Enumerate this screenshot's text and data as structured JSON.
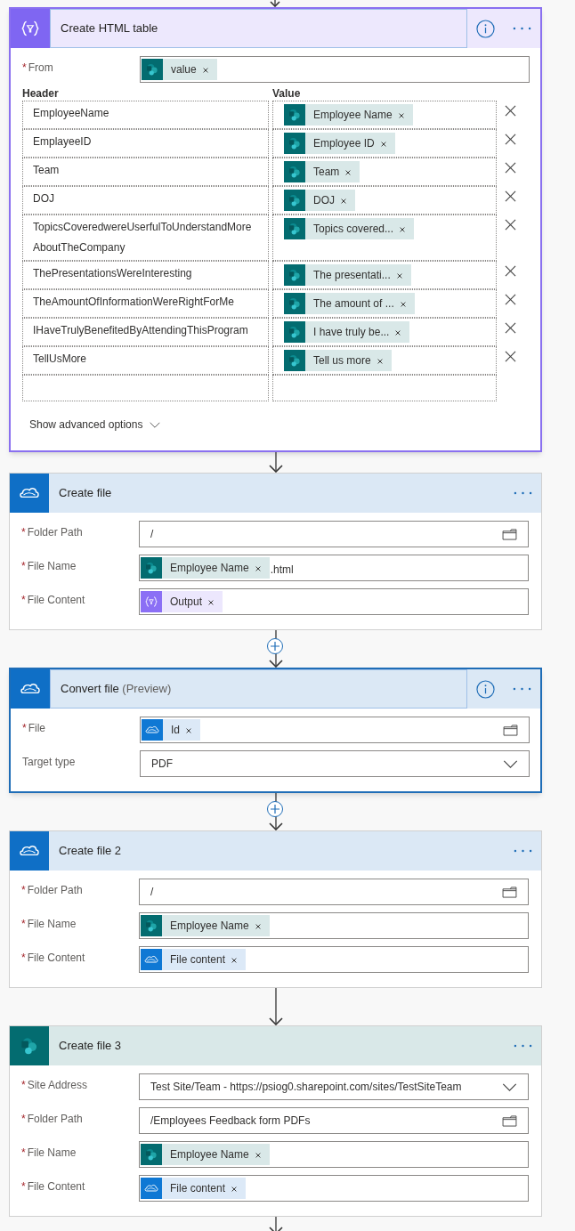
{
  "actions": [
    {
      "kind": "data_operation",
      "title": "Create HTML table",
      "selected": true,
      "fields": [
        {
          "label": "From",
          "required_mark": "*",
          "kind": "tokens",
          "tokens": [
            {
              "text": "value",
              "kind": "sharepoint"
            }
          ]
        }
      ],
      "table": {
        "headers": [
          "Header",
          "Value"
        ],
        "rows": [
          {
            "key": "EmployeeName",
            "token": {
              "text": "Employee Name",
              "kind": "sharepoint"
            }
          },
          {
            "key": "EmplayeeID",
            "token": {
              "text": "Employee ID",
              "kind": "sharepoint"
            }
          },
          {
            "key": "Team",
            "token": {
              "text": "Team",
              "kind": "sharepoint"
            }
          },
          {
            "key": "DOJ",
            "token": {
              "text": "DOJ",
              "kind": "sharepoint"
            }
          },
          {
            "key": "TopicsCoveredwereUserfulToUnderstandMoreAboutTheCompany",
            "token": {
              "text": "Topics covered...",
              "kind": "sharepoint"
            }
          },
          {
            "key": "ThePresentationsWereInteresting",
            "token": {
              "text": "The presentati...",
              "kind": "sharepoint"
            }
          },
          {
            "key": "TheAmountOfInformationWereRightForMe",
            "token": {
              "text": "The amount of ...",
              "kind": "sharepoint"
            }
          },
          {
            "key": "IHaveTrulyBenefitedByAttendingThisProgram",
            "token": {
              "text": "I have truly be...",
              "kind": "sharepoint"
            }
          },
          {
            "key": "TellUsMore",
            "token": {
              "text": "Tell us more",
              "kind": "sharepoint"
            }
          }
        ]
      },
      "advanced": "Show advanced options",
      "add_button_after": false
    },
    {
      "kind": "onedrive",
      "title": "Create file",
      "selected": false,
      "fields": [
        {
          "label": "Folder Path",
          "required_mark": "*",
          "kind": "text",
          "value": "/",
          "picker": true
        },
        {
          "label": "File Name",
          "required_mark": "*",
          "kind": "tokens",
          "tokens": [
            {
              "text": "Employee Name",
              "kind": "sharepoint"
            }
          ],
          "suffix": ".html"
        },
        {
          "label": "File Content",
          "required_mark": "*",
          "kind": "tokens",
          "tokens": [
            {
              "text": "Output",
              "kind": "data_operation"
            }
          ]
        }
      ],
      "add_button_after": true
    },
    {
      "kind": "onedrive",
      "title": "Convert file",
      "note": "(Preview)",
      "selected": true,
      "fields": [
        {
          "label": "File",
          "required_mark": "*",
          "kind": "tokens",
          "tokens": [
            {
              "text": "Id",
              "kind": "onedrive"
            }
          ],
          "picker": true
        },
        {
          "label": "Target type",
          "kind": "dropdown",
          "value": "PDF"
        }
      ],
      "add_button_after": true
    },
    {
      "kind": "onedrive",
      "title": "Create file 2",
      "selected": false,
      "fields": [
        {
          "label": "Folder Path",
          "required_mark": "*",
          "kind": "text",
          "value": "/",
          "picker": true
        },
        {
          "label": "File Name",
          "required_mark": "*",
          "kind": "tokens",
          "tokens": [
            {
              "text": "Employee Name",
              "kind": "sharepoint"
            }
          ]
        },
        {
          "label": "File Content",
          "required_mark": "*",
          "kind": "tokens",
          "tokens": [
            {
              "text": "File content",
              "kind": "onedrive"
            }
          ]
        }
      ],
      "add_button_after": false
    },
    {
      "kind": "sharepoint",
      "title": "Create file 3",
      "selected": false,
      "fields": [
        {
          "label": "Site Address",
          "required_mark": "*",
          "kind": "dropdown",
          "value": "Test Site/Team - https://psiog0.sharepoint.com/sites/TestSiteTeam"
        },
        {
          "label": "Folder Path",
          "required_mark": "*",
          "kind": "text",
          "value": "/Employees Feedback form PDFs",
          "picker": true
        },
        {
          "label": "File Name",
          "required_mark": "*",
          "kind": "tokens",
          "tokens": [
            {
              "text": "Employee Name",
              "kind": "sharepoint"
            }
          ]
        },
        {
          "label": "File Content",
          "required_mark": "*",
          "kind": "tokens",
          "tokens": [
            {
              "text": "File content",
              "kind": "onedrive"
            }
          ]
        }
      ],
      "add_button_after": false
    }
  ]
}
